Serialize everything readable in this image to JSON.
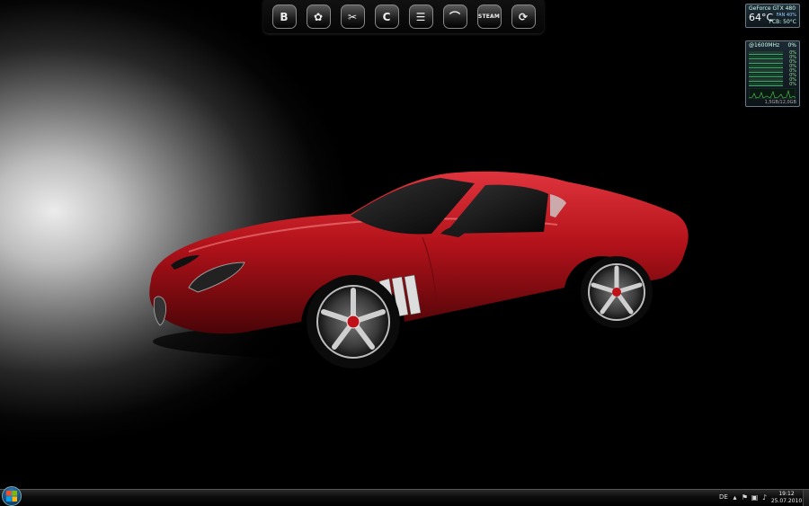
{
  "dock": {
    "items": [
      {
        "name": "steelseries",
        "glyph": "B"
      },
      {
        "name": "mushroom",
        "glyph": "✿"
      },
      {
        "name": "tools",
        "glyph": "✂"
      },
      {
        "name": "ccleaner",
        "glyph": "C"
      },
      {
        "name": "library",
        "glyph": "☰"
      },
      {
        "name": "avira",
        "glyph": "⌒"
      },
      {
        "name": "steam",
        "label": "STEAM"
      },
      {
        "name": "system",
        "glyph": "⟳"
      }
    ]
  },
  "gpu_gadget": {
    "name": "GeForce GTX 480",
    "temp": "64°C",
    "fan": "FAN 40%",
    "pcb": "PCB: 50°C"
  },
  "cpu_gadget": {
    "clock": "@1600MHz",
    "total": "0%",
    "cores": [
      "0%",
      "0%",
      "0%",
      "0%",
      "0%",
      "0%",
      "0%",
      "0%"
    ],
    "memory": "1,5GB/12,0GB"
  },
  "taskbar": {
    "language": "DE",
    "time": "19:12",
    "date": "25.07.2010"
  }
}
